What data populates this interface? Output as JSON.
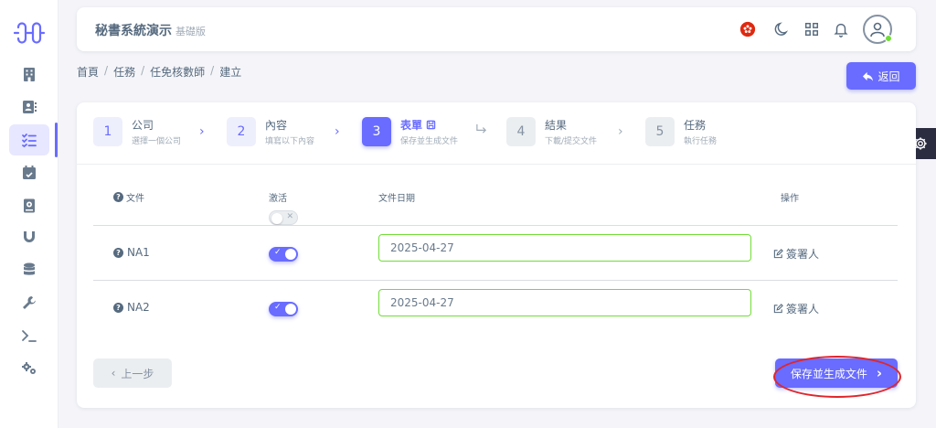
{
  "colors": {
    "accent": "#696cff",
    "success": "#71dd37",
    "annotation": "#e0252b",
    "flag": "#de2910"
  },
  "sidebar": {
    "logo_icon": "brand-logo",
    "items": [
      {
        "icon": "building-icon",
        "active": false
      },
      {
        "icon": "contact-card-icon",
        "active": false
      },
      {
        "icon": "task-list-icon",
        "active": true
      },
      {
        "icon": "calendar-icon",
        "active": false
      },
      {
        "icon": "book-icon",
        "active": false
      },
      {
        "icon": "magnet-icon",
        "active": false
      },
      {
        "icon": "database-icon",
        "active": false
      },
      {
        "icon": "wrench-icon",
        "active": false
      },
      {
        "icon": "terminal-icon",
        "active": false
      },
      {
        "icon": "gears-icon",
        "active": false
      }
    ]
  },
  "header": {
    "title": "秘書系統演示",
    "edition": "基礎版",
    "icons": [
      "hk-flag-icon",
      "moon-icon",
      "grid-icon",
      "bell-icon",
      "user-avatar-icon"
    ]
  },
  "breadcrumb": [
    "首頁",
    "任務",
    "任免核數師",
    "建立"
  ],
  "back_button": "返回",
  "steps": [
    {
      "num": "1",
      "title": "公司",
      "sub": "選擇一個公司",
      "state": "done"
    },
    {
      "num": "2",
      "title": "內容",
      "sub": "填寫以下內容",
      "state": "done"
    },
    {
      "num": "3",
      "title": "表單",
      "sub": "保存並生成文件",
      "state": "active"
    },
    {
      "num": "4",
      "title": "結果",
      "sub": "下載/提交文件",
      "state": "pending"
    },
    {
      "num": "5",
      "title": "任務",
      "sub": "執行任務",
      "state": "pending"
    }
  ],
  "table": {
    "headers": {
      "file": "文件",
      "active": "激活",
      "date": "文件日期",
      "action": "操作"
    },
    "rows": [
      {
        "name": "NA1",
        "active": true,
        "date": "2025-04-27",
        "action": "簽署人"
      },
      {
        "name": "NA2",
        "active": true,
        "date": "2025-04-27",
        "action": "簽署人"
      }
    ]
  },
  "buttons": {
    "prev": "上一步",
    "save": "保存並生成文件"
  }
}
